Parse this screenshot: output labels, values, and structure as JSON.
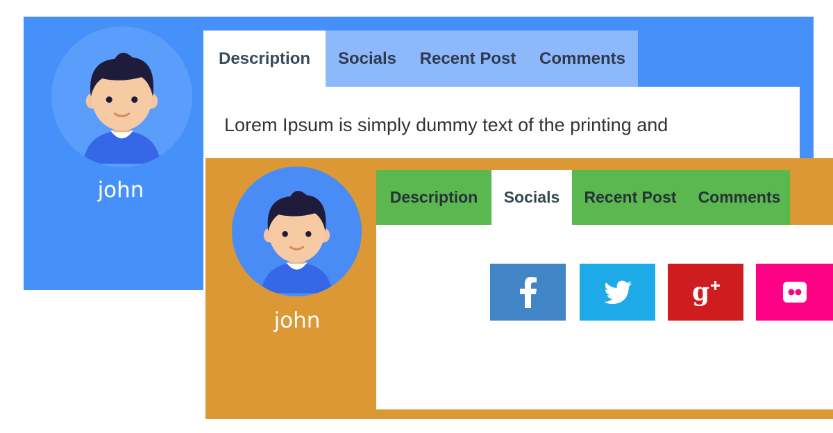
{
  "profile_card_blue": {
    "user_name": "john",
    "tabs": [
      {
        "label": "Description",
        "active": true
      },
      {
        "label": "Socials",
        "active": false
      },
      {
        "label": "Recent Post",
        "active": false
      },
      {
        "label": "Comments",
        "active": false
      }
    ],
    "description_text": "Lorem Ipsum is simply dummy text of the printing and",
    "colors": {
      "background": "#4690fa",
      "tabbar": "#8db8fc"
    }
  },
  "profile_card_orange": {
    "user_name": "john",
    "tabs": [
      {
        "label": "Description",
        "active": false
      },
      {
        "label": "Socials",
        "active": true
      },
      {
        "label": "Recent Post",
        "active": false
      },
      {
        "label": "Comments",
        "active": false
      }
    ],
    "social_buttons": [
      {
        "icon": "facebook-icon",
        "color": "#4185c6"
      },
      {
        "icon": "twitter-icon",
        "color": "#1eaae8"
      },
      {
        "icon": "google-plus-icon",
        "color": "#cf1d1f"
      },
      {
        "icon": "flickr-icon",
        "color": "#fe0184"
      }
    ],
    "colors": {
      "background": "#db9834",
      "tabbar": "#5bb74f"
    }
  }
}
